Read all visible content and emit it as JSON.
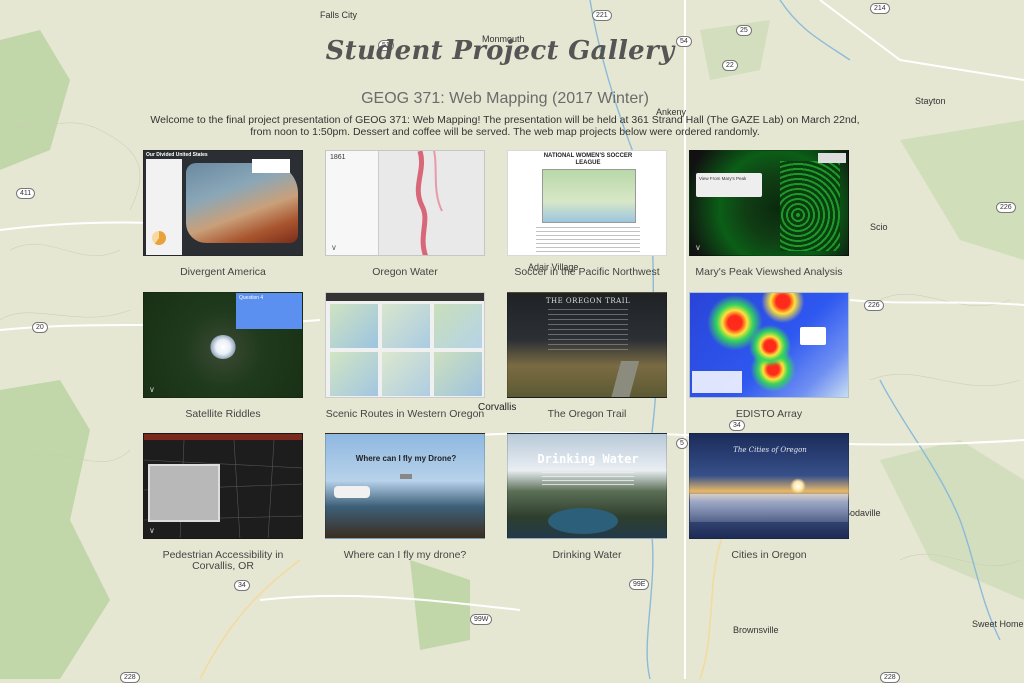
{
  "header": {
    "title": "Student Project Gallery",
    "subtitle": "GEOG 371: Web Mapping (2017 Winter)",
    "intro": "Welcome to the final project presentation of GEOG 371: Web Mapping! The presentation will be held at 361 Strand Hall (The GAZE Lab) on March 22nd, from noon to 1:50pm. Dessert and coffee will be served. The web map projects below were ordered randomly."
  },
  "map": {
    "places": [
      "Falls City",
      "Monmouth",
      "Stayton",
      "Scio",
      "Adair Village",
      "Corvallis",
      "Ankeny",
      "Brownsville",
      "Sweet Home",
      "Sodaville"
    ],
    "shields": [
      "214",
      "51",
      "22",
      "25",
      "54",
      "221",
      "99W",
      "411",
      "20",
      "34",
      "226",
      "226",
      "228",
      "228",
      "34",
      "5",
      "99E"
    ]
  },
  "projects": [
    {
      "name": "Divergent America",
      "thumb_text": "Our Divided United States"
    },
    {
      "name": "Oregon Water",
      "thumb_text": "1861"
    },
    {
      "name": "Soccer in the Pacific Northwest",
      "thumb_text": "NATIONAL WOMEN'S SOCCER LEAGUE"
    },
    {
      "name": "Mary's Peak Viewshed Analysis",
      "thumb_text": "View From Mary's Peak"
    },
    {
      "name": "Satellite Riddles",
      "thumb_text": "Question 4"
    },
    {
      "name": "Scenic Routes in Western Oregon",
      "thumb_text": ""
    },
    {
      "name": "The Oregon Trail",
      "thumb_text": "THE OREGON TRAIL"
    },
    {
      "name": "EDISTO Array",
      "thumb_text": ""
    },
    {
      "name": "Pedestrian Accessibility in Corvallis, OR",
      "thumb_text": ""
    },
    {
      "name": "Where can I fly my drone?",
      "thumb_text": "Where can I fly my Drone?"
    },
    {
      "name": "Drinking Water",
      "thumb_text": "Drinking Water"
    },
    {
      "name": "Cities in Oregon",
      "thumb_text": "The Cities of Oregon"
    }
  ],
  "colors": {
    "map_bg": "#e4e6cf",
    "forest": "#a7c98f",
    "road": "#ffffff",
    "water": "#7fb2d6",
    "title": "#555555"
  }
}
